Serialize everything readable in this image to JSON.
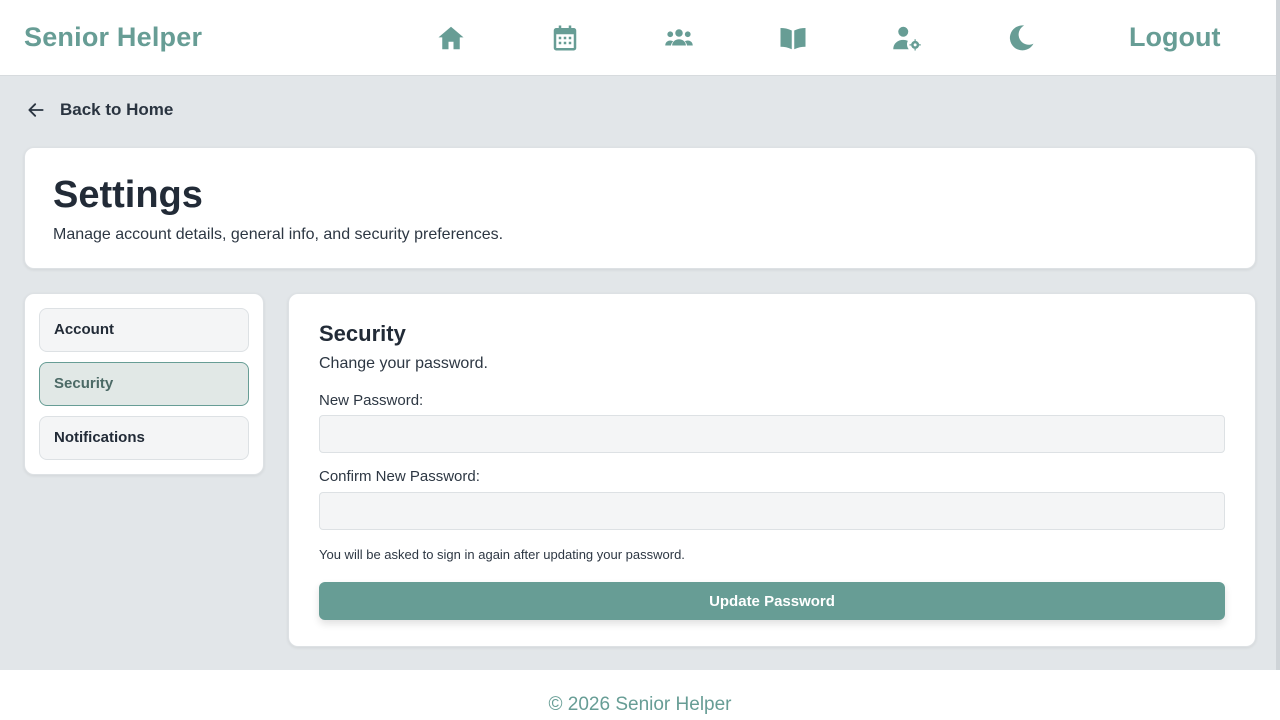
{
  "header": {
    "brand": "Senior Helper",
    "nav_icons": [
      "home-icon",
      "calendar-icon",
      "users-icon",
      "book-icon",
      "user-gear-icon",
      "moon-icon"
    ],
    "logout_label": "Logout",
    "accent_color": "#679d95"
  },
  "back": {
    "label": "Back to Home",
    "icon": "arrow-left-icon"
  },
  "page": {
    "title": "Settings",
    "subtitle": "Manage account details, general info, and security preferences."
  },
  "sidebar": {
    "items": [
      {
        "label": "Account",
        "active": false
      },
      {
        "label": "Security",
        "active": true
      },
      {
        "label": "Notifications",
        "active": false
      }
    ]
  },
  "security": {
    "title": "Security",
    "subtitle": "Change your password.",
    "new_password_label": "New Password:",
    "new_password_value": "",
    "confirm_password_label": "Confirm New Password:",
    "confirm_password_value": "",
    "hint": "You will be asked to sign in again after updating your password.",
    "update_button": "Update Password"
  },
  "footer": {
    "text": "© 2026 Senior Helper"
  }
}
